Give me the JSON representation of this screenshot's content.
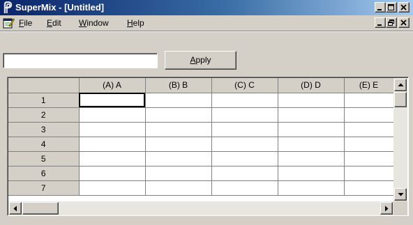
{
  "window": {
    "title": "SuperMix - [Untitled]"
  },
  "menu": {
    "file": {
      "u": "F",
      "rest": "ile"
    },
    "edit": {
      "u": "E",
      "rest": "dit"
    },
    "window": {
      "u": "W",
      "rest": "indow"
    },
    "help": {
      "u": "H",
      "rest": "elp"
    }
  },
  "toolbar": {
    "formula_value": "",
    "apply": {
      "u": "A",
      "rest": "pply"
    }
  },
  "grid": {
    "columns": [
      "(A) A",
      "(B) B",
      "(C) C",
      "(D) D",
      "(E) E"
    ],
    "rows": [
      "1",
      "2",
      "3",
      "4",
      "5",
      "6",
      "7"
    ],
    "active_cell": "A1"
  },
  "icons": {
    "app": "supermix-app-icon",
    "document": "document-edit-icon",
    "minimize": "minimize-icon",
    "maximize": "maximize-icon",
    "restore": "restore-icon",
    "close": "close-icon",
    "scroll_up": "arrow-up-icon",
    "scroll_down": "arrow-down-icon",
    "scroll_left": "arrow-left-icon",
    "scroll_right": "arrow-right-icon"
  },
  "colors": {
    "title_gradient_start": "#0a246a",
    "title_gradient_end": "#a6caf0",
    "face": "#d4d0c8"
  }
}
